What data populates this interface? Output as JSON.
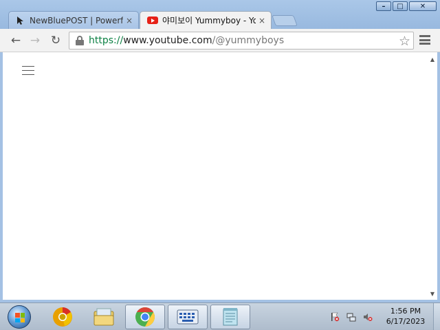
{
  "browser": {
    "tabs": [
      {
        "title": "NewBluePOST | Powerful",
        "favicon": "cursor-arrow-icon",
        "active": false
      },
      {
        "title": "야미보이 Yummyboy - Yo",
        "favicon": "youtube-icon",
        "active": true
      }
    ],
    "close_glyph": "×",
    "window_controls": {
      "minimize": "–",
      "maximize": "□",
      "close": "✕"
    }
  },
  "toolbar": {
    "back_glyph": "←",
    "forward_glyph": "→",
    "reload_glyph": "↻",
    "url": {
      "scheme": "https://",
      "host": "www.youtube.com",
      "path": "/@yummyboys"
    },
    "bookmark_glyph": "☆"
  },
  "page": {
    "scroll_up_glyph": "▲",
    "scroll_down_glyph": "▼"
  },
  "taskbar": {
    "pinned": [
      {
        "name": "chrome-canary-taskbar-button",
        "open": false
      },
      {
        "name": "file-explorer-taskbar-button",
        "open": false
      },
      {
        "name": "chrome-taskbar-button",
        "open": true
      },
      {
        "name": "keyboard-app-taskbar-button",
        "open": true
      },
      {
        "name": "notepad-taskbar-button",
        "open": true
      }
    ],
    "clock": {
      "time": "1:56 PM",
      "date": "6/17/2023"
    }
  },
  "colors": {
    "accent_frame": "#a4c1e4",
    "url_secure": "#0b8043",
    "youtube_red": "#e62117"
  }
}
